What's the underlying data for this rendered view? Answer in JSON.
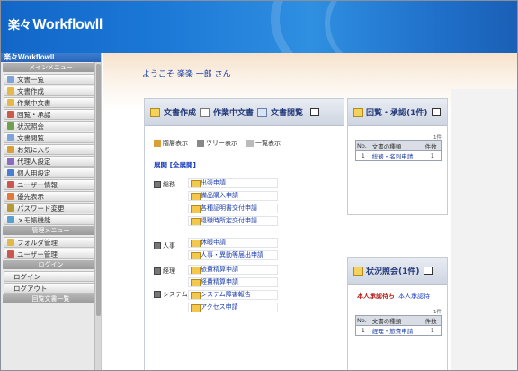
{
  "app": {
    "logo_mark": "楽々",
    "logo_text": "Workflowll"
  },
  "sidebar": {
    "title": "楽々Workflowll",
    "section_menu": "メインメニュー",
    "menu": [
      {
        "label": "文書一覧",
        "icon": "doc-list-icon",
        "color": "#7da3d9"
      },
      {
        "label": "文書作成",
        "icon": "doc-create-icon",
        "color": "#e6b84a"
      },
      {
        "label": "作業中文書",
        "icon": "doc-working-icon",
        "color": "#e6b84a"
      },
      {
        "label": "回覧・承認",
        "icon": "approve-icon",
        "color": "#c95b4a"
      },
      {
        "label": "状況照会",
        "icon": "status-icon",
        "color": "#6fa04f"
      },
      {
        "label": "文書閲覧",
        "icon": "doc-view-icon",
        "color": "#7da3d9"
      },
      {
        "label": "お気に入り",
        "icon": "favorite-icon",
        "color": "#d9a03a"
      },
      {
        "label": "代理人設定",
        "icon": "proxy-icon",
        "color": "#8a6dbf"
      },
      {
        "label": "個人用設定",
        "icon": "personal-settings-icon",
        "color": "#4a7fcf"
      },
      {
        "label": "ユーザー情報",
        "icon": "user-info-icon",
        "color": "#c9584e"
      },
      {
        "label": "優先表示",
        "icon": "priority-icon",
        "color": "#e07a3a"
      },
      {
        "label": "パスワード変更",
        "icon": "password-icon",
        "color": "#b59a3a"
      },
      {
        "label": "メモ帳機能",
        "icon": "memo-icon",
        "color": "#5a9fd0"
      }
    ],
    "section_admin": "管理メニュー",
    "admin": [
      {
        "label": "フォルダ管理",
        "icon": "folder-admin-icon",
        "color": "#e0b94a"
      },
      {
        "label": "ユーザー管理",
        "icon": "user-admin-icon",
        "color": "#c9584e"
      }
    ],
    "section_login": "ログイン",
    "login": [
      {
        "label": "ログイン"
      },
      {
        "label": "ログアウト"
      }
    ],
    "bottom": "回覧文書一覧"
  },
  "main": {
    "welcome": "ようこそ 楽楽 一郎 さん",
    "tabs": [
      "文書作成",
      "作業中文書",
      "文書閲覧"
    ],
    "views": [
      "階層表示",
      "ツリー表示",
      "一覧表示"
    ],
    "expand": "展開 [全展開]",
    "groups": [
      "総務",
      "人事",
      "経理",
      "システム"
    ],
    "forms": [
      "出張申請",
      "備品購入申請",
      "各種証明書交付申請",
      "退職時所定交付申請",
      "休暇申請",
      "人事・異動等届出申請",
      "旅費精算申請",
      "経費精算申請",
      "システム障害報告",
      "アクセス申請"
    ]
  },
  "approve": {
    "title": "回覧・承認(1件)",
    "count": "1件",
    "cols": [
      "No.",
      "文書の種類",
      "件数"
    ],
    "rows": [
      {
        "no": "1",
        "name": "総務・名刺申請",
        "cnt": "1"
      }
    ]
  },
  "status": {
    "title": "状況照会(1件)",
    "person": "本人承認待ち",
    "person_link": "本人承認待",
    "count": "1件",
    "cols": [
      "No.",
      "文書の種類",
      "件数"
    ],
    "rows": [
      {
        "no": "1",
        "name": "経理・旅費申請",
        "cnt": "1"
      }
    ]
  }
}
